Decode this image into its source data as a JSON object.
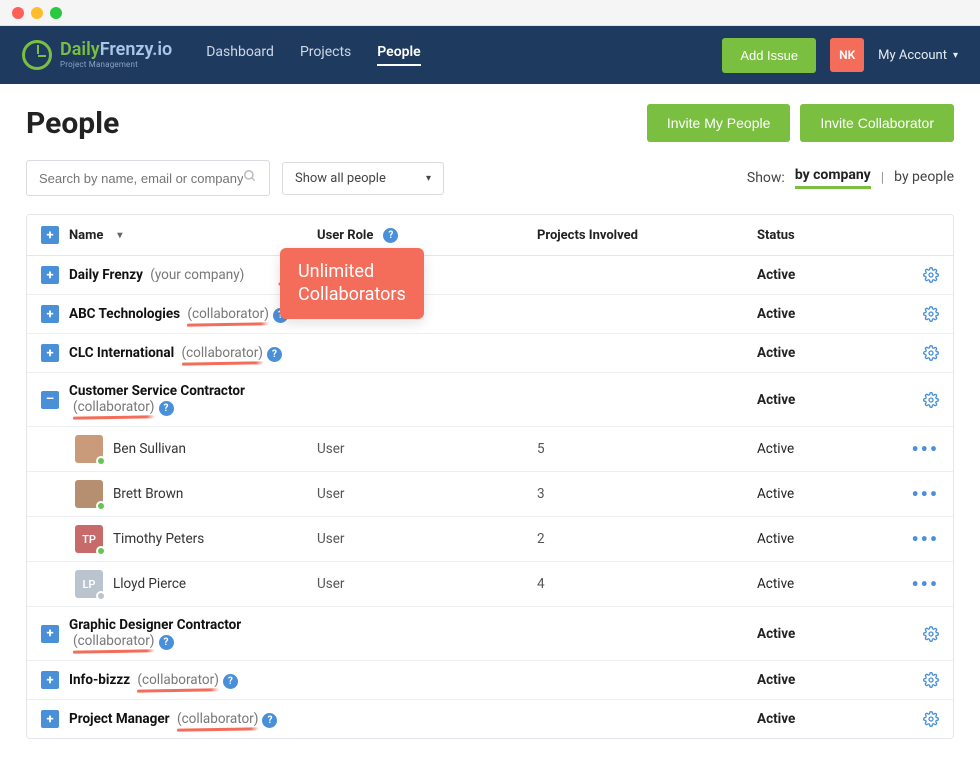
{
  "brand": {
    "name_a": "Daily",
    "name_b": "Frenzy.io",
    "sub": "Project Management"
  },
  "nav": {
    "dashboard": "Dashboard",
    "projects": "Projects",
    "people": "People"
  },
  "topbar": {
    "add_issue": "Add Issue",
    "user_initials": "NK",
    "account": "My Account"
  },
  "page": {
    "title": "People",
    "invite_people": "Invite My People",
    "invite_collab": "Invite Collaborator"
  },
  "search": {
    "placeholder": "Search by name, email or company name"
  },
  "filter": {
    "selected": "Show all people"
  },
  "show": {
    "label": "Show:",
    "by_company": "by company",
    "by_people": "by people"
  },
  "callout": {
    "line1": "Unlimited",
    "line2": "Collaborators"
  },
  "columns": {
    "name": "Name",
    "role": "User Role",
    "projects": "Projects Involved",
    "status": "Status"
  },
  "companies": [
    {
      "name": "Daily Frenzy",
      "tag": "(your company)",
      "status": "Active",
      "collab": false,
      "expanded": false
    },
    {
      "name": "ABC Technologies",
      "tag": "(collaborator)",
      "status": "Active",
      "collab": true,
      "expanded": false
    },
    {
      "name": "CLC International",
      "tag": "(collaborator)",
      "status": "Active",
      "collab": true,
      "expanded": false
    },
    {
      "name": "Customer Service Contractor",
      "tag": "(collaborator)",
      "status": "Active",
      "collab": true,
      "expanded": true,
      "people": [
        {
          "name": "Ben Sullivan",
          "role": "User",
          "projects": "5",
          "status": "Active",
          "ava_bg": "#c99b7a",
          "initials": "",
          "presence": "#61c653"
        },
        {
          "name": "Brett Brown",
          "role": "User",
          "projects": "3",
          "status": "Active",
          "ava_bg": "#b58f70",
          "initials": "",
          "presence": "#61c653"
        },
        {
          "name": "Timothy Peters",
          "role": "User",
          "projects": "2",
          "status": "Active",
          "ava_bg": "#c86a6a",
          "initials": "TP",
          "presence": "#61c653"
        },
        {
          "name": "Lloyd Pierce",
          "role": "User",
          "projects": "4",
          "status": "Active",
          "ava_bg": "#b9c4cf",
          "initials": "LP",
          "presence": "#bcc3cb"
        }
      ]
    },
    {
      "name": "Graphic Designer Contractor",
      "tag": "(collaborator)",
      "status": "Active",
      "collab": true,
      "expanded": false
    },
    {
      "name": "Info-bizzz",
      "tag": "(collaborator)",
      "status": "Active",
      "collab": true,
      "expanded": false
    },
    {
      "name": "Project Manager",
      "tag": "(collaborator)",
      "status": "Active",
      "collab": true,
      "expanded": false
    }
  ]
}
